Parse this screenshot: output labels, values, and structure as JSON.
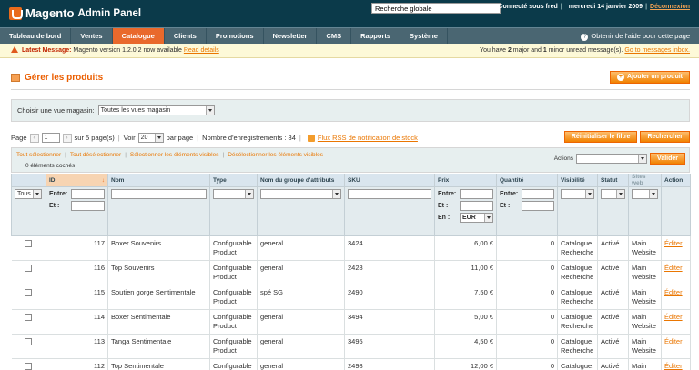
{
  "header": {
    "logo_brand": "Magento",
    "logo_sub": "Admin Panel",
    "search_value": "Recherche globale",
    "user_text": "Connecté sous fred",
    "date": "mercredi 14 janvier 2009",
    "logout": "Déconnexion"
  },
  "nav": {
    "items": [
      "Tableau de bord",
      "Ventes",
      "Catalogue",
      "Clients",
      "Promotions",
      "Newsletter",
      "CMS",
      "Rapports",
      "Système"
    ],
    "active": "Catalogue",
    "help": "Obtenir de l'aide pour cette page"
  },
  "message": {
    "label": "Latest Message:",
    "text": "Magento version 1.2.0.2 now available",
    "link": "Read details",
    "right_prefix": "You have",
    "major": "2",
    "major_text": "major and",
    "minor": "1",
    "minor_text": "minor unread message(s).",
    "inbox_link": "Go to messages inbox."
  },
  "page": {
    "title": "Gérer les produits",
    "add_button": "Ajouter un produit"
  },
  "store": {
    "label": "Choisir une vue magasin:",
    "value": "Toutes les vues magasin"
  },
  "pager": {
    "page_label": "Page",
    "page_value": "1",
    "of_pages": "sur 5 page(s)",
    "view_label": "Voir",
    "view_value": "20",
    "per_page": "par page",
    "records": "Nombre d'enregistrements : 84",
    "rss": "Flux RSS de notification de stock",
    "reset_button": "Réinitialiser le filtre",
    "search_button": "Rechercher"
  },
  "mass": {
    "select_all": "Tout sélectionner",
    "unselect_all": "Tout désélectionner",
    "select_visible": "Sélectionner les éléments visibles",
    "unselect_visible": "Désélectionner les éléments visibles",
    "count": "0 éléments cochés",
    "actions_label": "Actions",
    "submit": "Valider"
  },
  "columns": [
    "",
    "ID",
    "Nom",
    "Type",
    "Nom du groupe d'attributs",
    "SKU",
    "Prix",
    "Quantité",
    "Visibilité",
    "Statut",
    "Sites web",
    "Action"
  ],
  "filter": {
    "massaction_value": "Tous",
    "from_label": "Entre:",
    "to_label": "Et :",
    "currency_label": "En :",
    "currency_value": "EUR"
  },
  "rows": [
    {
      "id": "117",
      "name": "Boxer Souvenirs",
      "type": "Configurable Product",
      "attr_set": "general",
      "sku": "3424",
      "price": "6,00 €",
      "qty": "0",
      "visibility": "Catalogue, Recherche",
      "status": "Activé",
      "websites": "Main Website",
      "action": "Éditer"
    },
    {
      "id": "116",
      "name": "Top Souvenirs",
      "type": "Configurable Product",
      "attr_set": "general",
      "sku": "2428",
      "price": "11,00 €",
      "qty": "0",
      "visibility": "Catalogue, Recherche",
      "status": "Activé",
      "websites": "Main Website",
      "action": "Éditer"
    },
    {
      "id": "115",
      "name": "Soutien gorge Sentimentale",
      "type": "Configurable Product",
      "attr_set": "spé SG",
      "sku": "2490",
      "price": "7,50 €",
      "qty": "0",
      "visibility": "Catalogue, Recherche",
      "status": "Activé",
      "websites": "Main Website",
      "action": "Éditer"
    },
    {
      "id": "114",
      "name": "Boxer Sentimentale",
      "type": "Configurable Product",
      "attr_set": "general",
      "sku": "3494",
      "price": "5,00 €",
      "qty": "0",
      "visibility": "Catalogue, Recherche",
      "status": "Activé",
      "websites": "Main Website",
      "action": "Éditer"
    },
    {
      "id": "113",
      "name": "Tanga Sentimentale",
      "type": "Configurable Product",
      "attr_set": "general",
      "sku": "3495",
      "price": "4,50 €",
      "qty": "0",
      "visibility": "Catalogue, Recherche",
      "status": "Activé",
      "websites": "Main Website",
      "action": "Éditer"
    },
    {
      "id": "112",
      "name": "Top Sentimentale",
      "type": "Configurable Product",
      "attr_set": "general",
      "sku": "2498",
      "price": "12,00 €",
      "qty": "0",
      "visibility": "Catalogue, Recherche",
      "status": "Activé",
      "websites": "Main Website",
      "action": "Éditer"
    }
  ],
  "colors": {
    "accent": "#eb5e00",
    "header": "#0b3a4a",
    "nav": "#4a6672",
    "active_tab": "#e9692c"
  }
}
